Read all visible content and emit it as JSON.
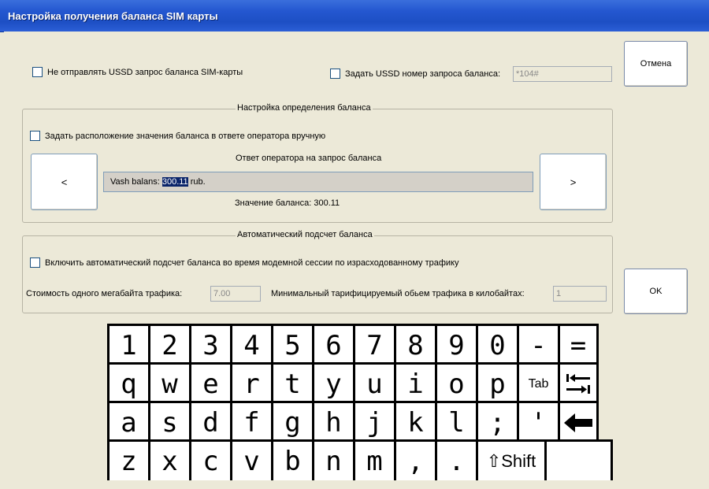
{
  "window": {
    "title": "Настройка получения баланса SIM карты"
  },
  "buttons": {
    "cancel": "Отмена",
    "ok": "OK",
    "prev": "<",
    "next": ">"
  },
  "ussd": {
    "no_send_label": "Не отправлять USSD запрос баланса SIM-карты",
    "set_number_label": "Задать USSD номер запроса баланса:",
    "number_value": "*104#"
  },
  "balance_setup": {
    "legend": "Настройка определения баланса",
    "manual_label": "Задать расположение значения баланса в ответе оператора вручную",
    "response_caption": "Ответ оператора на запрос баланса",
    "response_prefix": "Vash balans: ",
    "response_selected": "300.11",
    "response_suffix": " rub.",
    "value_label": "Значение баланса:  300.11"
  },
  "auto_calc": {
    "legend": "Автоматический подсчет баланса",
    "enable_label": "Включить автоматический подсчет баланса во время модемной сессии по израсходованному трафику",
    "mb_cost_label": "Стоимость одного мегабайта трафика:",
    "mb_cost_value": "7.00",
    "min_kb_label": "Минимальный тарифицируемый обьем трафика в килобайтах:",
    "min_kb_value": "1"
  },
  "keyboard": {
    "row1": [
      "1",
      "2",
      "3",
      "4",
      "5",
      "6",
      "7",
      "8",
      "9",
      "0",
      "-",
      "="
    ],
    "row2": [
      "q",
      "w",
      "e",
      "r",
      "t",
      "y",
      "u",
      "i",
      "o",
      "p",
      "Tab"
    ],
    "row3": [
      "a",
      "s",
      "d",
      "f",
      "g",
      "h",
      "j",
      "k",
      "l",
      ";",
      "'"
    ],
    "row4": [
      "z",
      "x",
      "c",
      "v",
      "b",
      "n",
      "m",
      ",",
      "."
    ],
    "shift_label": "⇧Shift",
    "icons": {
      "tab_arrows": "tab-arrows-icon",
      "backspace": "backspace-arrow-icon"
    }
  }
}
